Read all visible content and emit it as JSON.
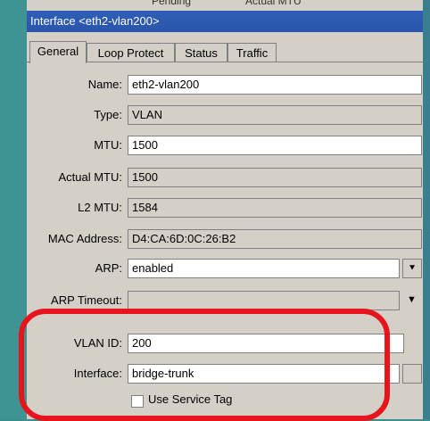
{
  "background": {
    "partial_texts": [
      "...",
      "Pending",
      "Actual MTU"
    ]
  },
  "window": {
    "title": "Interface <eth2-vlan200>"
  },
  "tabs": [
    {
      "label": "General",
      "active": true
    },
    {
      "label": "Loop Protect",
      "active": false
    },
    {
      "label": "Status",
      "active": false
    },
    {
      "label": "Traffic",
      "active": false
    }
  ],
  "form": {
    "name": {
      "label": "Name:",
      "value": "eth2-vlan200"
    },
    "type": {
      "label": "Type:",
      "value": "VLAN"
    },
    "mtu": {
      "label": "MTU:",
      "value": "1500"
    },
    "actual_mtu": {
      "label": "Actual MTU:",
      "value": "1500"
    },
    "l2_mtu": {
      "label": "L2 MTU:",
      "value": "1584"
    },
    "mac_address": {
      "label": "MAC Address:",
      "value": "D4:CA:6D:0C:26:B2"
    },
    "arp": {
      "label": "ARP:",
      "value": "enabled"
    },
    "arp_timeout": {
      "label": "ARP Timeout:",
      "value": ""
    },
    "vlan_id": {
      "label": "VLAN ID:",
      "value": "200"
    },
    "interface": {
      "label": "Interface:",
      "value": "bridge-trunk"
    },
    "use_service_tag": {
      "label": "Use Service Tag",
      "checked": false
    }
  },
  "icons": {
    "dropdown": "▼",
    "dropdown_boxed": "⯆"
  },
  "colors": {
    "title_bar": "#2f5fb8",
    "highlight": "#e8141c",
    "background": "#3a8f8e",
    "panel": "#d4d0c8"
  }
}
